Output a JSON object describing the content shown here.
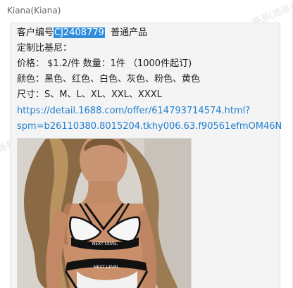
{
  "sender": {
    "name": "Kiana(Kiana)"
  },
  "watermark": {
    "text": "路易(路易)"
  },
  "message": {
    "sku_prefix": "客户编号",
    "sku_code": "CJ2408779",
    "sku_suffix": "  普通产品",
    "custom_line": "定制比基尼：",
    "price_line": "价格： $1.2/件  数量：1件 （1000件起订)",
    "colors_line": "颜色：黑色、红色、白色、灰色、粉色、黄色",
    "sizes_line": "尺寸：S、M、L、XL、XXL、XXXL",
    "link_line1": "https://detail.1688.com/offer/614793714574.html?",
    "link_line2": "spm=b26110380.8015204.tkhy006.63.f90561efmOM46N"
  },
  "photo": {
    "bikini_text_top": "NEXT LEVEL",
    "bikini_text_bottom": "NEXT LEVEL"
  }
}
